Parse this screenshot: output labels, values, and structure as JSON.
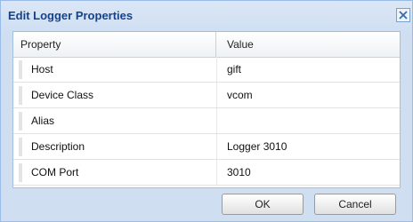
{
  "dialog": {
    "title": "Edit Logger Properties",
    "close_icon": "close-icon"
  },
  "grid": {
    "columns": [
      "Property",
      "Value"
    ],
    "rows": [
      {
        "property": "Host",
        "value": "gift"
      },
      {
        "property": "Device Class",
        "value": "vcom"
      },
      {
        "property": "Alias",
        "value": ""
      },
      {
        "property": "Description",
        "value": "Logger 3010"
      },
      {
        "property": "COM Port",
        "value": "3010"
      }
    ]
  },
  "buttons": {
    "ok_label": "OK",
    "cancel_label": "Cancel"
  },
  "colors": {
    "title_text": "#15428b",
    "dialog_bg": "#cfdef0",
    "border": "#99bbe8"
  }
}
